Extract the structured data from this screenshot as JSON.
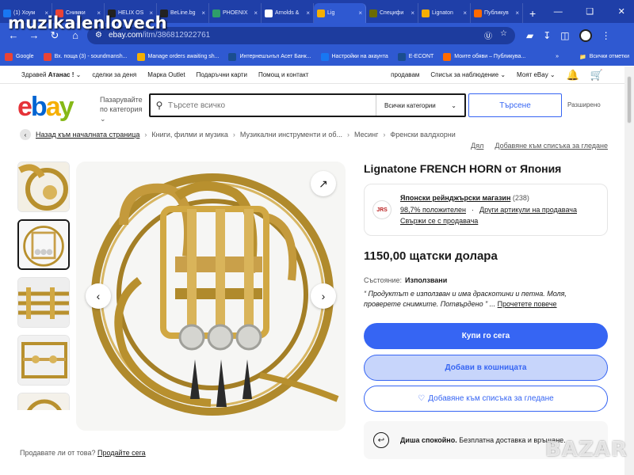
{
  "watermark": "muzikalenlovech",
  "browser": {
    "tabs": [
      {
        "label": "(1) Хоум",
        "color": "#1877f2"
      },
      {
        "label": "Снимки",
        "color": "#ea4335"
      },
      {
        "label": "HELIX OS",
        "color": "#222222"
      },
      {
        "label": "BeLine.bg",
        "color": "#222222"
      },
      {
        "label": "PHOENIX",
        "color": "#2e9e6b"
      },
      {
        "label": "Arnolds &",
        "color": "#ffffff"
      },
      {
        "label": "Lig",
        "color": "#f5af02",
        "active": true
      },
      {
        "label": "Специфи",
        "color": "#6b6b00"
      },
      {
        "label": "Lignaton",
        "color": "#f5af02"
      },
      {
        "label": "Публикув",
        "color": "#ff6a00"
      }
    ],
    "url_host": "ebay.com",
    "url_path": "/itm/386812922761",
    "bookmarks": [
      {
        "label": "Google",
        "color": "#ea4335"
      },
      {
        "label": "Вх. поща (3) - soundmansh...",
        "color": "#ea4335"
      },
      {
        "label": "Manage orders awaiting sh...",
        "color": "#f5af02"
      },
      {
        "label": "Интернешънъл Асет Банк...",
        "color": "#1a4d8f"
      },
      {
        "label": "Настройки на акаунта",
        "color": "#1877f2"
      },
      {
        "label": "E-ECONT",
        "color": "#1a4d8f"
      },
      {
        "label": "Моите обяви – Публикува...",
        "color": "#ff6a00"
      }
    ],
    "bookmarks_more": "»",
    "all_bookmarks": "Всички отметки"
  },
  "topnav": {
    "greeting": "Здравей",
    "user": "Атанас !",
    "left_links": [
      "сделки за деня",
      "Марка Outlet",
      "Подаръчни карти",
      "Помощ и контакт"
    ],
    "right_links": [
      "продавам",
      "Списък за наблюдение",
      "Моят eBay"
    ]
  },
  "header": {
    "logo": {
      "e": "e",
      "b": "b",
      "a": "a",
      "y": "y"
    },
    "shop_by": "Пазарувайте по категория",
    "search_placeholder": "Търсете всичко",
    "category_select": "Всички категории",
    "search_button": "Търсене",
    "advanced": "Разширено"
  },
  "breadcrumb": {
    "back": "Назад към началната страница",
    "items": [
      "Книги, филми и музика",
      "Музикални инструменти и об...",
      "Месинг",
      "Френски валдхорни"
    ]
  },
  "share": {
    "share": "Дял",
    "watchlist": "Добавяне към списъка за гледане"
  },
  "listing": {
    "title": "Lignatone FRENCH HORN от Япония",
    "seller_name": "Японски рейнджърски магазин",
    "seller_count": "(238)",
    "seller_positive": "98,7% положителен",
    "seller_other": "Други артикули на продавача",
    "seller_contact": "Свържи се с продавача",
    "seller_logo_text": "JRS",
    "price": "1150,00 щатски долара",
    "condition_label": "Състояние:",
    "condition_value": "Използвани",
    "description": "“ Продуктът е използван и има драскотини и петна. Моля, проверете снимките. Потвърдено ” ...",
    "read_more": "Прочетете повече",
    "buy_now": "Купи го сега",
    "add_to_cart": "Добави в кошницата",
    "add_to_watchlist": "Добавяне към списъка за гледане",
    "shipping_bold": "Диша спокойно.",
    "shipping_text": "Безплатна доставка и връщане."
  },
  "sell_prompt": {
    "question": "Продавате ли от това?",
    "link": "Продайте сега"
  },
  "bazar_watermark": "BAZAR",
  "icons": {
    "search": "search-icon",
    "bell": "bell-icon",
    "cart": "cart-icon",
    "expand": "expand-icon",
    "heart": "heart-icon"
  }
}
